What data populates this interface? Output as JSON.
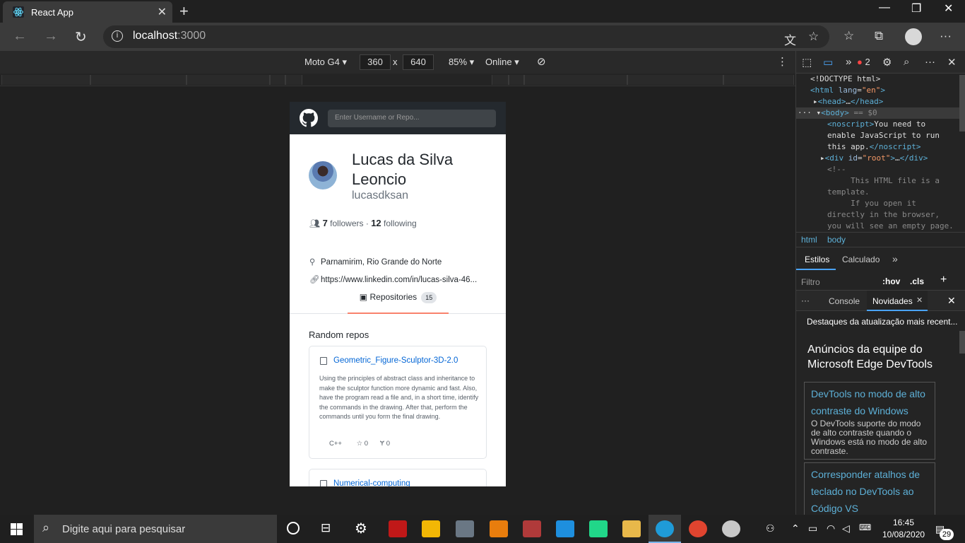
{
  "browser": {
    "tab_title": "React App",
    "url_host": "localhost",
    "url_port": ":3000"
  },
  "device_toolbar": {
    "device": "Moto G4",
    "width": "360",
    "times": "x",
    "height": "640",
    "zoom": "85%",
    "network": "Online"
  },
  "app": {
    "search_placeholder": "Enter Username or Repo...",
    "name": "Lucas da Silva Leoncio",
    "login": "lucasdksan",
    "followers_count": "7",
    "followers_label": "followers",
    "dot": "·",
    "following_count": "12",
    "following_label": "following",
    "location": "Parnamirim, Rio Grande do Norte",
    "blog": "https://www.linkedin.com/in/lucas-silva-46...",
    "tab_label": "Repositories",
    "tab_count": "15",
    "section_title": "Random repos",
    "repos": [
      {
        "title": "Geometric_Figure-Sculptor-3D-2.0",
        "description": "Using the principles of abstract class and inheritance to make the sculptor function more dynamic and fast. Also, have the program read a file and, in a short time, identify the commands in the drawing. After that, perform the commands until you form the final drawing.",
        "language": "C++",
        "stars": "0",
        "forks": "0"
      },
      {
        "title": "Numerical-computing"
      }
    ]
  },
  "devtools": {
    "issues_count": "2",
    "breadcrumb_html": "html",
    "breadcrumb_body": "body",
    "tab_styles": "Estilos",
    "tab_computed": "Calculado",
    "filter_placeholder": "Filtro",
    "hov": ":hov",
    "cls": ".cls",
    "drawer_console": "Console",
    "drawer_news": "Novidades",
    "news_highlight": "Destaques da atualização mais recent...",
    "announce_title": "Anúncios da equipe do Microsoft Edge DevTools",
    "news_items": [
      {
        "title": "DevTools no modo de alto contraste do Windows",
        "desc": "O DevTools suporte do modo de alto contraste quando o Windows está no modo de alto contraste."
      },
      {
        "title": "Corresponder atalhos de teclado no DevTools ao Código VS"
      }
    ]
  },
  "taskbar": {
    "search_placeholder": "Digite aqui para pesquisar",
    "time": "16:45",
    "date": "10/08/2020",
    "notifications": "29"
  }
}
